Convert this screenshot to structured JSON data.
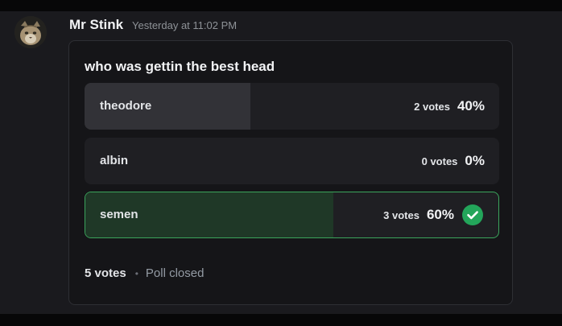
{
  "message": {
    "author": "Mr Stink",
    "timestamp": "Yesterday at 11:02 PM",
    "avatar_icon": "cat-avatar"
  },
  "poll": {
    "question": "who was gettin the best head",
    "answers": [
      {
        "label": "theodore",
        "votes": "2 votes",
        "percent": "40%",
        "fraction": 0.4,
        "winner": false
      },
      {
        "label": "albin",
        "votes": "0 votes",
        "percent": "0%",
        "fraction": 0.0,
        "winner": false
      },
      {
        "label": "semen",
        "votes": "3 votes",
        "percent": "60%",
        "fraction": 0.6,
        "winner": true
      }
    ],
    "total_votes": "5 votes",
    "separator": "•",
    "status": "Poll closed",
    "colors": {
      "winner_border": "#3ba55c",
      "winner_fill": "#1f3827",
      "bar_fill": "#323237",
      "check": "#23a55a"
    }
  }
}
